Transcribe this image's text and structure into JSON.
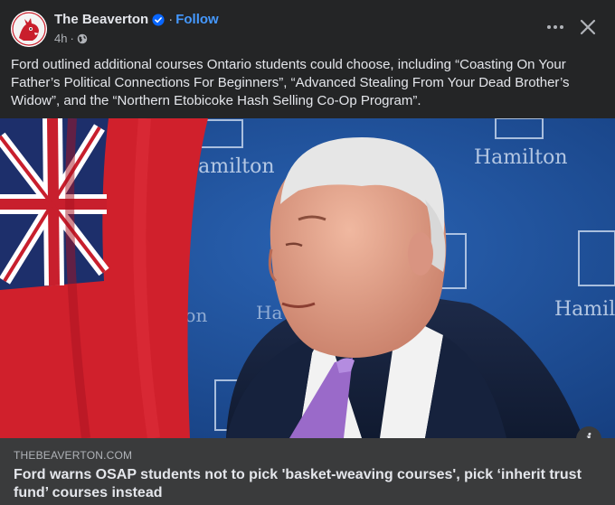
{
  "post": {
    "page_name": "The Beaverton",
    "follow_label": "Follow",
    "separator": "·",
    "time": "4h",
    "text": "Ford outlined additional courses Ontario students could choose, including “Coasting On Your Father’s Political Connections For Beginners”, “Advanced Stealing From Your Dead Brother’s Widow”, and the “Northern Etobicoke Hash Selling Co-Op Program”."
  },
  "photo": {
    "backdrop_text": "Hamilton",
    "backdrop_color": "#1f4f97",
    "flag_red": "#d0202c"
  },
  "link_preview": {
    "domain": "THEBEAVERTON.COM",
    "headline": "Ford warns OSAP students not to pick 'basket-weaving courses', pick ‘inherit trust fund’ courses instead",
    "info_icon": "i"
  },
  "colors": {
    "background": "#242526",
    "link_box": "#3a3b3c",
    "accent": "#4599ff",
    "text_primary": "#e4e6eb",
    "text_secondary": "#b0b3b8"
  }
}
